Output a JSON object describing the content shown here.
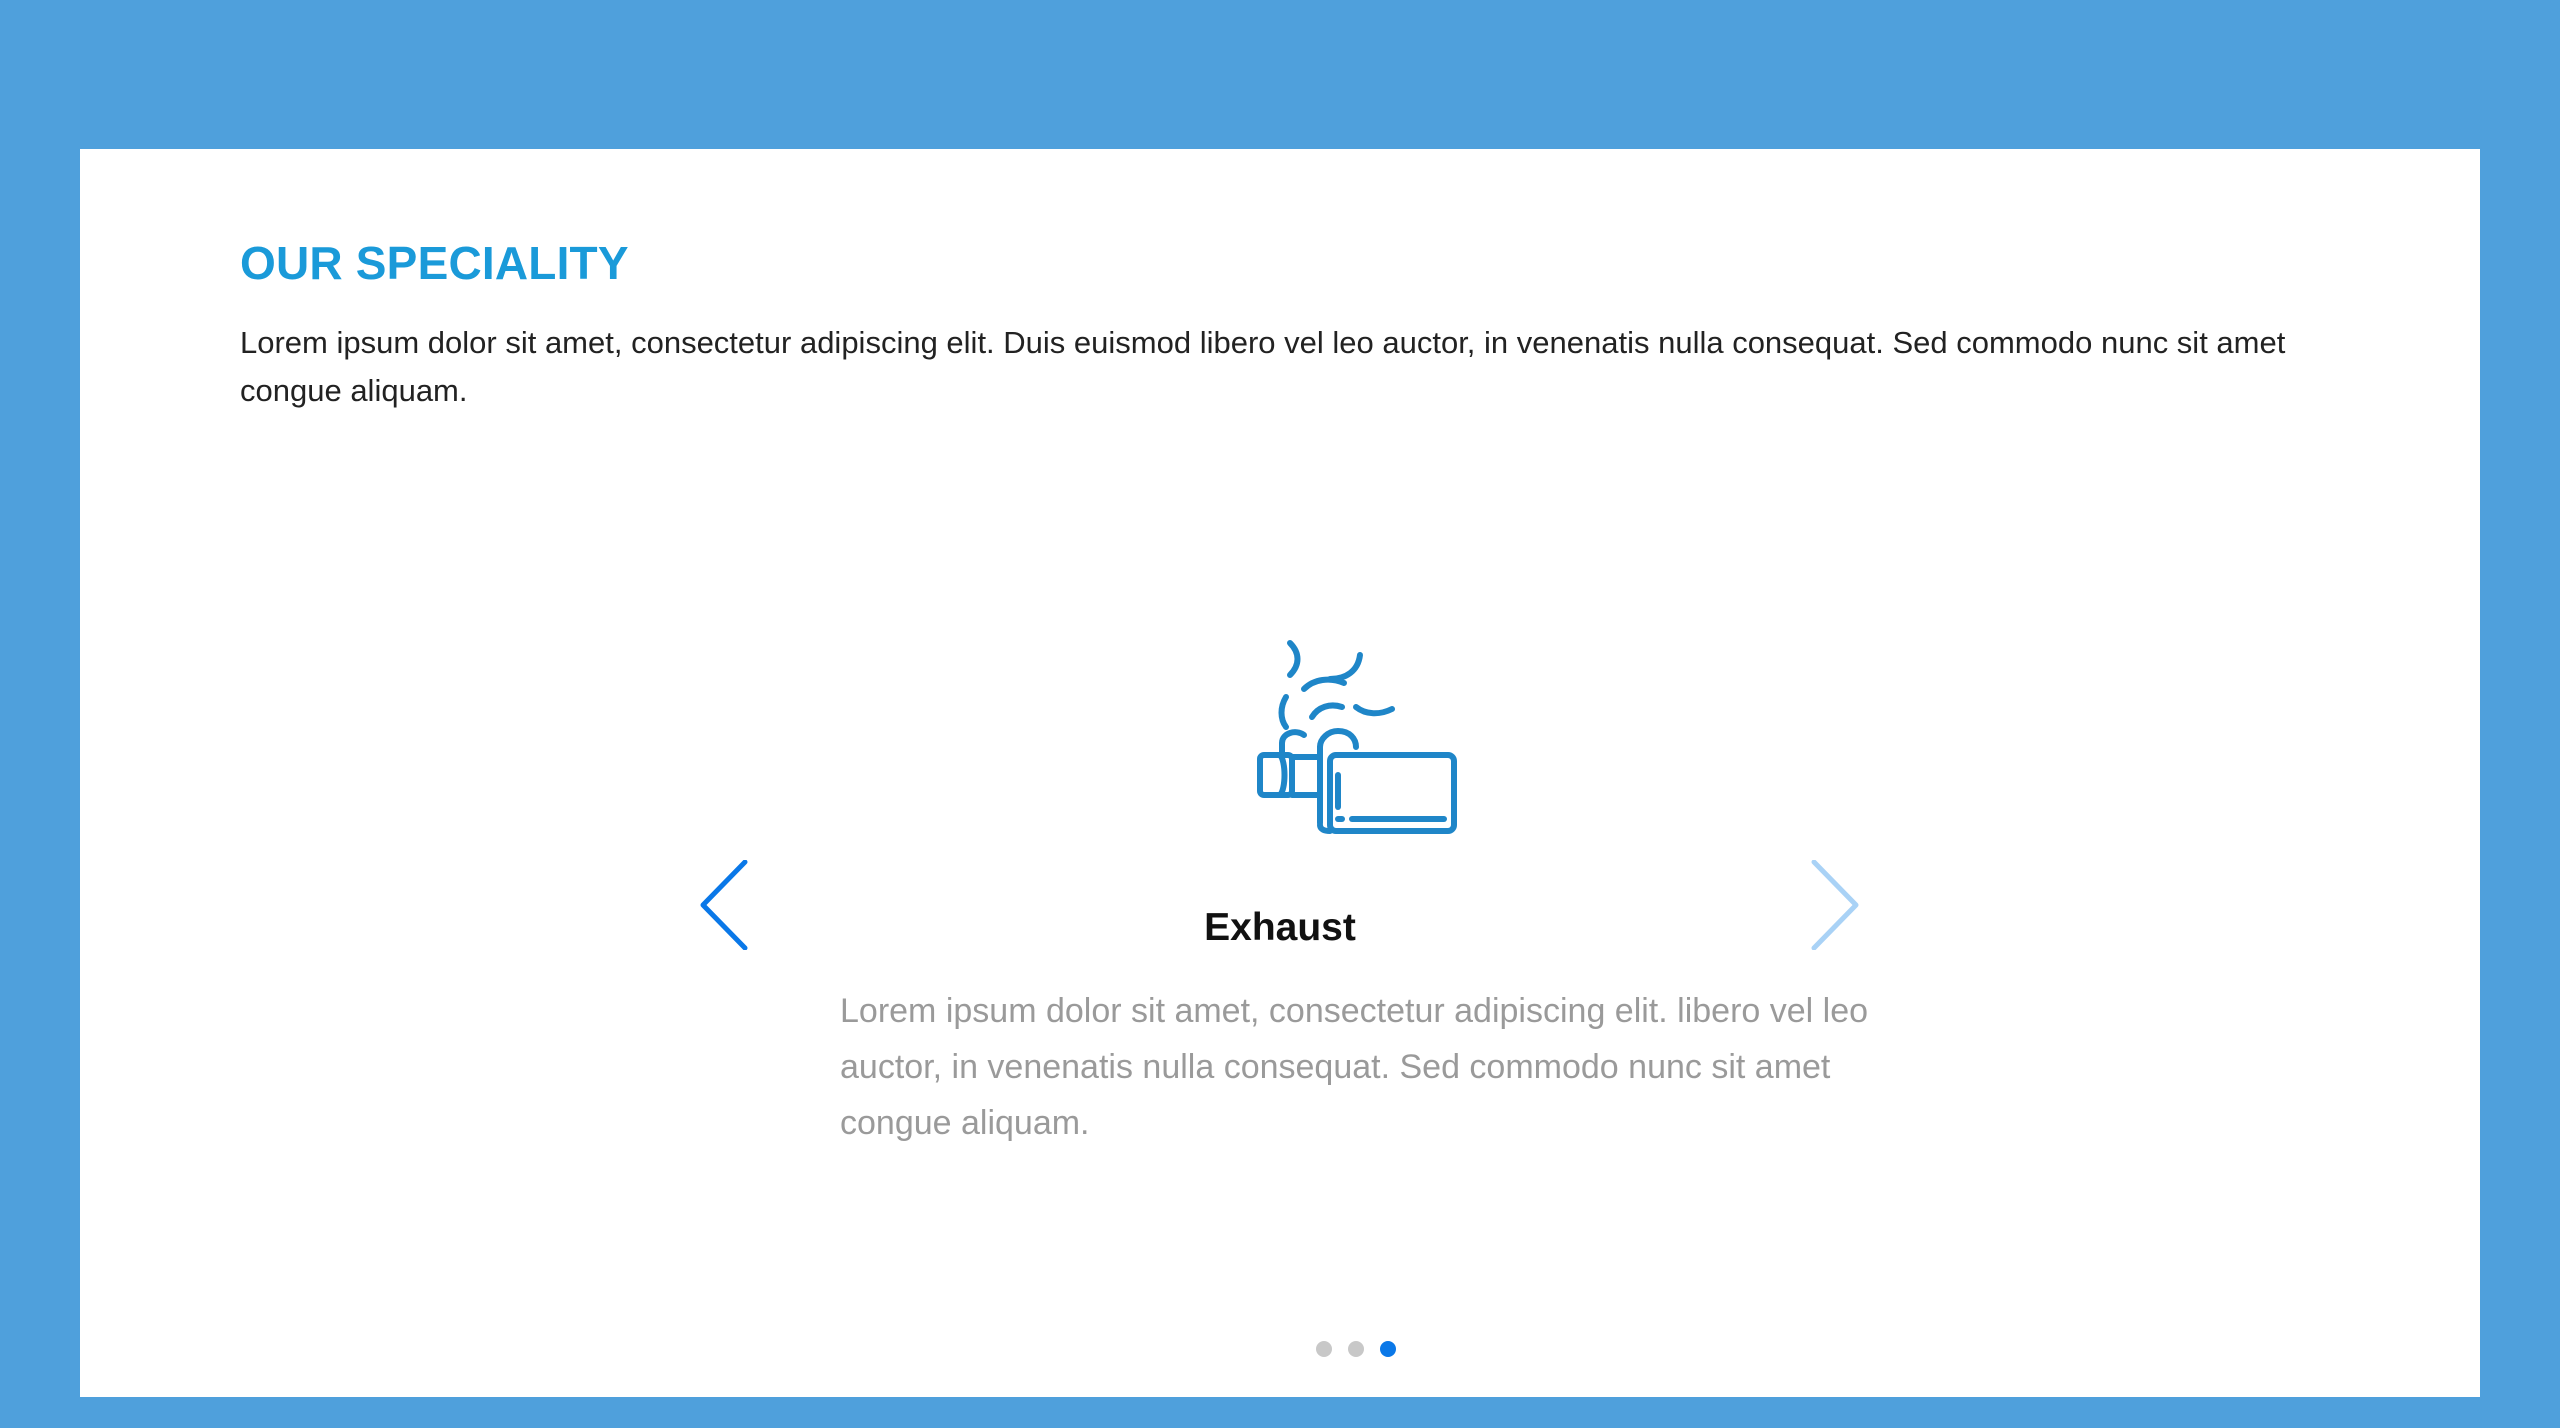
{
  "colors": {
    "page_background": "#4fa0dc",
    "panel_background": "#ffffff",
    "heading": "#1a9ad9",
    "icon_stroke": "#1f86c8",
    "arrow_active": "#0a78e8",
    "arrow_inactive": "#a9d2f6",
    "dot_inactive": "#c8c8c8",
    "dot_active": "#0a78e8"
  },
  "section": {
    "heading": "OUR SPECIALITY",
    "intro": "Lorem ipsum dolor sit amet, consectetur adipiscing elit. Duis euismod libero vel leo auctor, in venenatis nulla consequat. Sed commodo nunc sit amet congue aliquam."
  },
  "carousel": {
    "active_index": 2,
    "slide_count": 3,
    "prev_icon": "chevron-left-icon",
    "next_icon": "chevron-right-icon",
    "slide": {
      "icon": "exhaust-pipe-icon",
      "title": "Exhaust",
      "text": "Lorem ipsum dolor sit amet, consectetur adipiscing elit. libero vel leo auctor, in venenatis nulla consequat. Sed commodo nunc sit amet congue aliquam."
    }
  }
}
